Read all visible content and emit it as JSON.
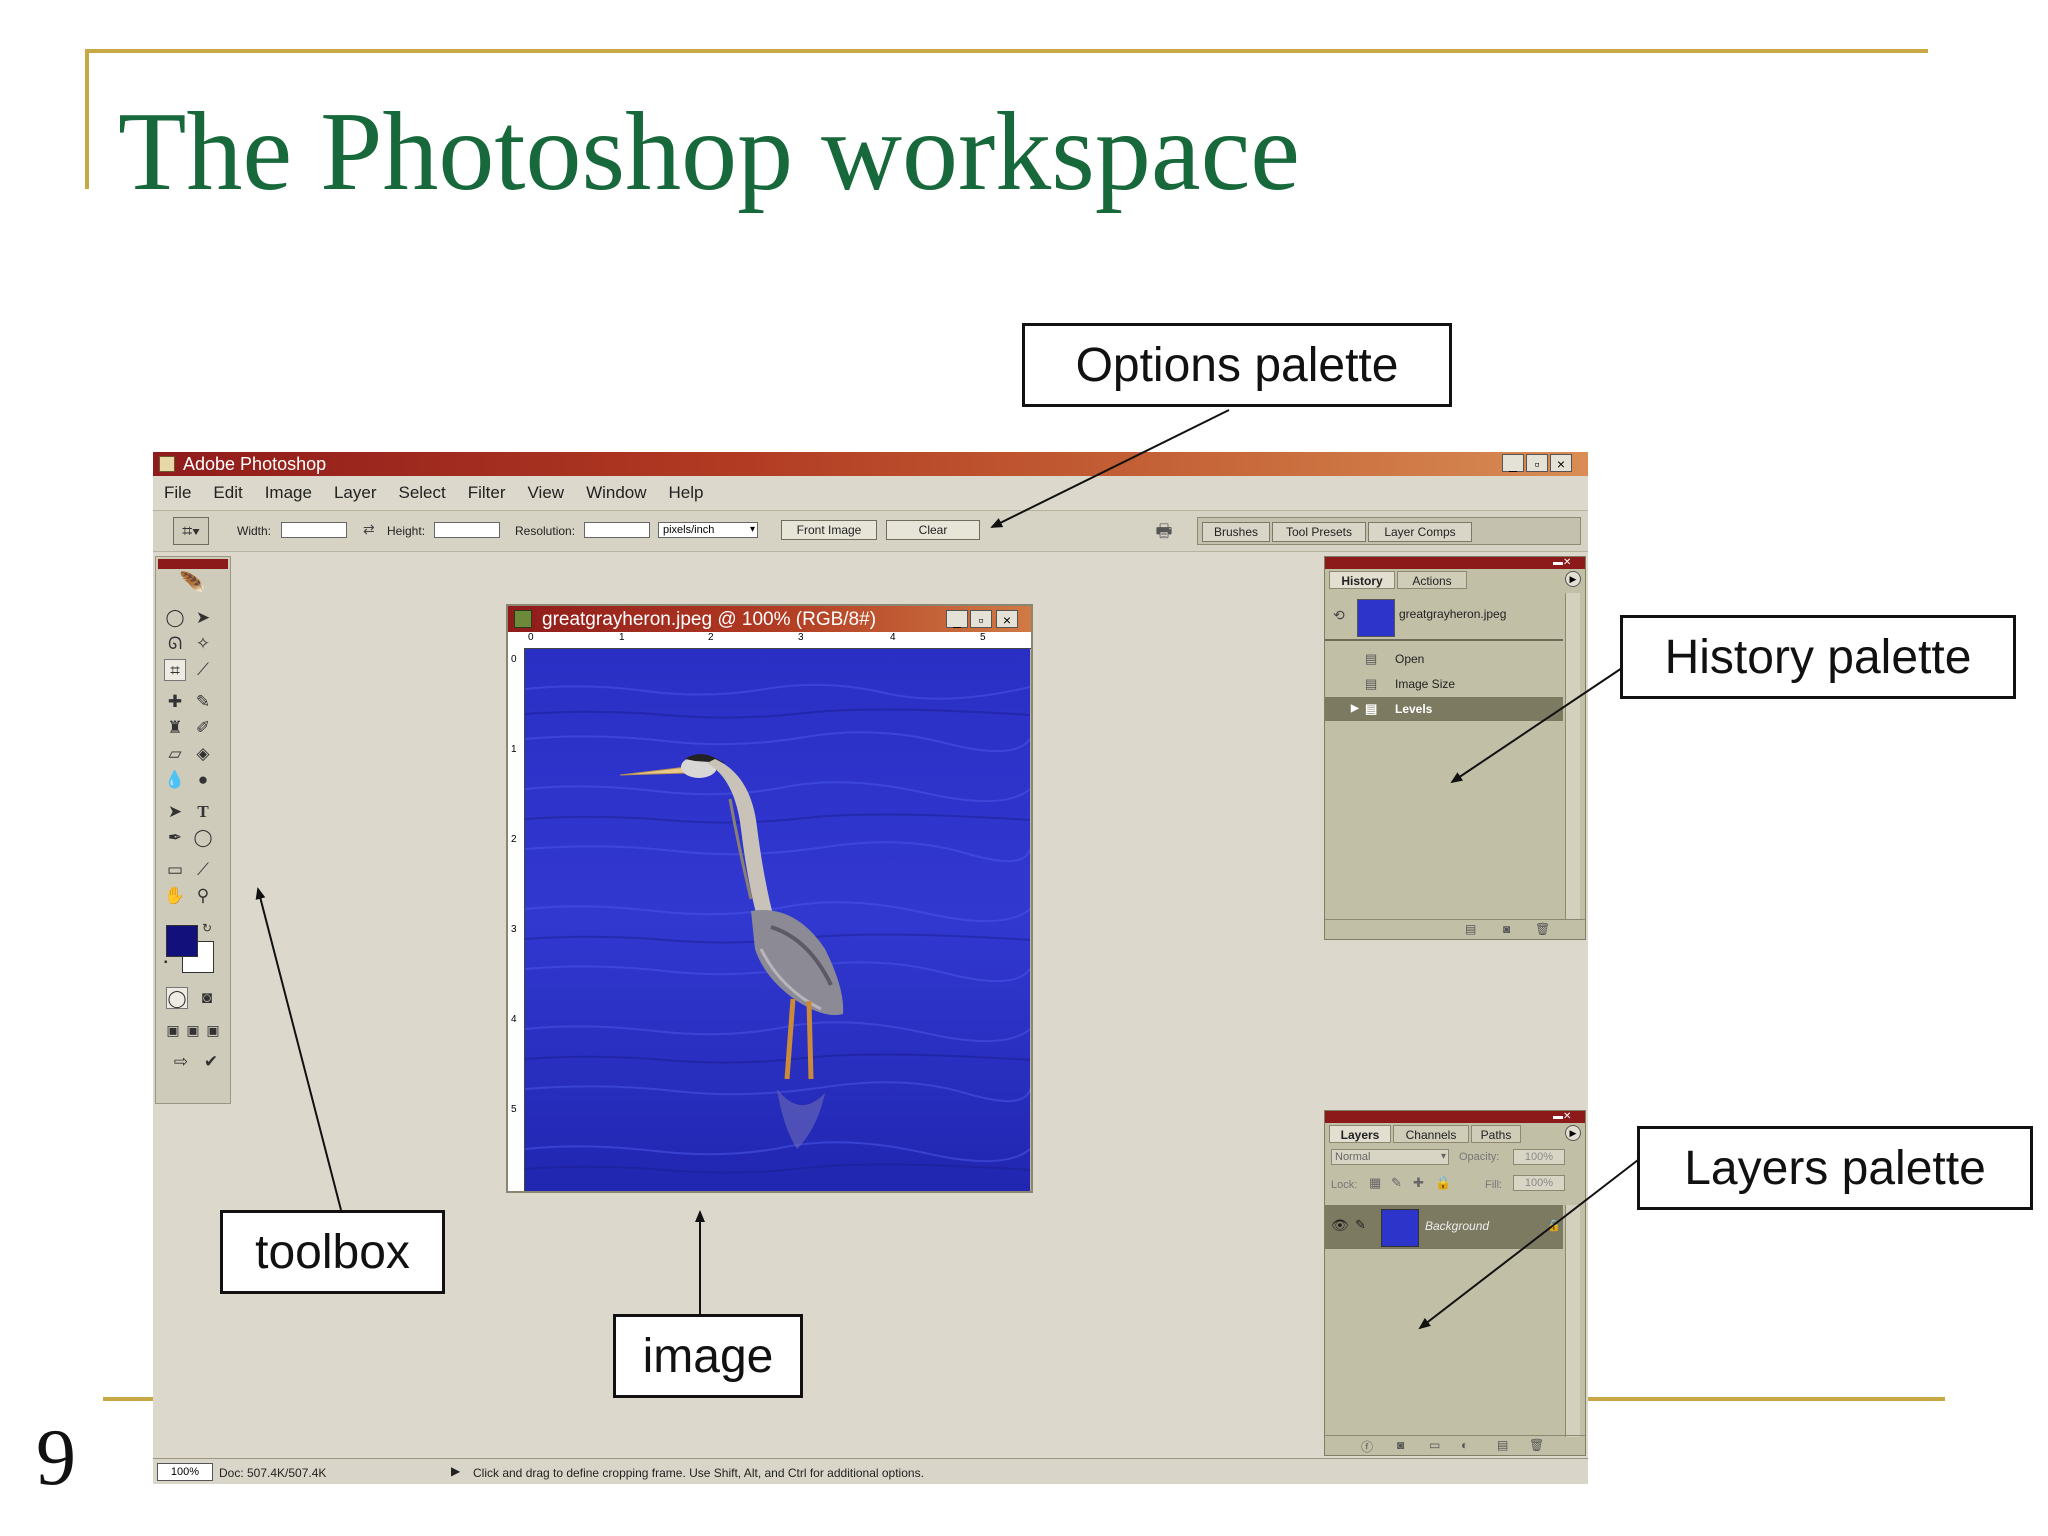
{
  "slide": {
    "title": "The Photoshop workspace",
    "number": "9"
  },
  "callouts": {
    "options": "Options palette",
    "history": "History palette",
    "layers": "Layers palette",
    "toolbox": "toolbox",
    "image": "image"
  },
  "app": {
    "title": "Adobe Photoshop",
    "window_buttons": [
      "_",
      "▫",
      "×"
    ],
    "menu": [
      "File",
      "Edit",
      "Image",
      "Layer",
      "Select",
      "Filter",
      "View",
      "Window",
      "Help"
    ]
  },
  "options_bar": {
    "width_label": "Width:",
    "height_label": "Height:",
    "resolution_label": "Resolution:",
    "units_value": "pixels/inch",
    "front_image_label": "Front Image",
    "clear_label": "Clear",
    "well_tabs": [
      "Brushes",
      "Tool Presets",
      "Layer Comps"
    ]
  },
  "document": {
    "title": "greatgrayheron.jpeg @ 100% (RGB/8#)",
    "ruler_h": [
      "0",
      "1",
      "2",
      "3",
      "4",
      "5"
    ],
    "ruler_v": [
      "0",
      "1",
      "2",
      "3",
      "4",
      "5"
    ]
  },
  "history_palette": {
    "tabs": [
      "History",
      "Actions"
    ],
    "snapshot": "greatgrayheron.jpeg",
    "states": [
      "Open",
      "Image Size",
      "Levels"
    ],
    "active_state": "Levels"
  },
  "layers_palette": {
    "tabs": [
      "Layers",
      "Channels",
      "Paths"
    ],
    "blend_mode": "Normal",
    "opacity_label": "Opacity:",
    "opacity_value": "100%",
    "lock_label": "Lock:",
    "fill_label": "Fill:",
    "fill_value": "100%",
    "layer_name": "Background"
  },
  "status_bar": {
    "zoom": "100%",
    "doc_size": "Doc: 507.4K/507.4K",
    "hint": "Click and drag to define cropping frame. Use Shift, Alt, and Ctrl for additional options."
  },
  "colors": {
    "title_green": "#17683a",
    "frame_gold": "#c8a845",
    "ps_background": "#dcd9cc",
    "foreground_swatch": "#12107a",
    "background_swatch": "#ffffff"
  }
}
